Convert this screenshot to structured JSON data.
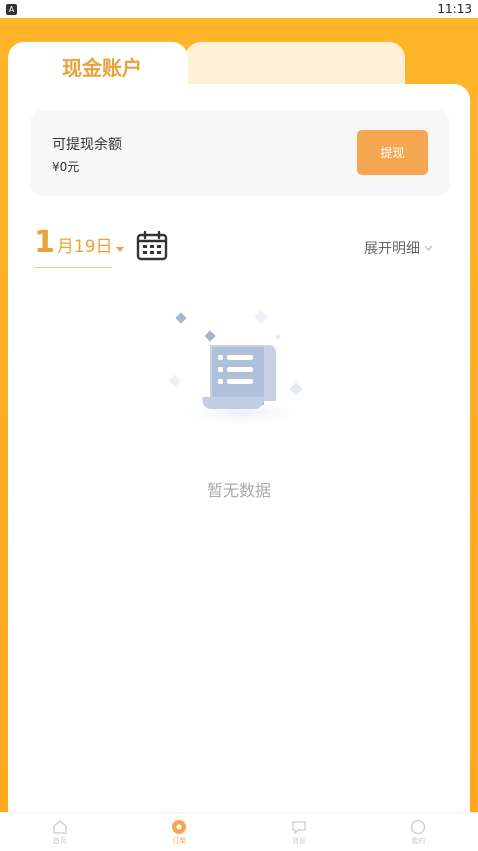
{
  "status_bar": {
    "time": "11:13",
    "badge": "A"
  },
  "tabs": {
    "active_label": "现金账户"
  },
  "balance": {
    "label": "可提现余额",
    "value": "¥0元",
    "withdraw_label": "提现"
  },
  "date_filter": {
    "month_num": "1",
    "rest": "月19日"
  },
  "expand_label": "展开明细",
  "empty_text": "暂无数据",
  "bottom_nav": [
    {
      "label": "首页",
      "icon": "home-icon"
    },
    {
      "label": "订单",
      "icon": "wallet-icon"
    },
    {
      "label": "消息",
      "icon": "chat-icon"
    },
    {
      "label": "我的",
      "icon": "user-icon"
    }
  ],
  "colors": {
    "accent": "#E8A33A",
    "button": "#F5A650",
    "bg": "#FFB52A"
  }
}
